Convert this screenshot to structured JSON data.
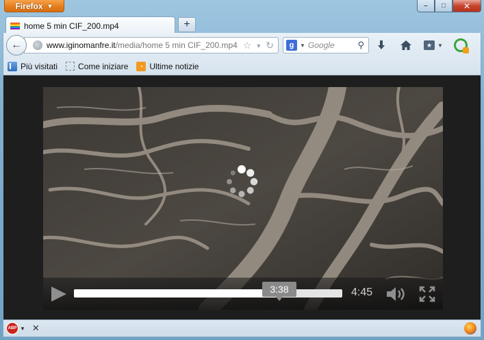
{
  "window": {
    "app_button_label": "Firefox",
    "controls": {
      "minimize": "–",
      "maximize": "□",
      "close": "✕"
    }
  },
  "tabs": [
    {
      "title": "home 5 min CIF_200.mp4",
      "favicon_colors": [
        "#e53935",
        "#fb8c00",
        "#fdd835",
        "#43a047",
        "#1e88e5",
        "#8e24aa"
      ]
    }
  ],
  "new_tab_label": "+",
  "navbar": {
    "url_domain": "www.iginomanfre.it",
    "url_path": "/media/home 5 min CIF_200.mp4",
    "search_engine_letter": "g",
    "search_placeholder": "Google"
  },
  "bookmarks": [
    {
      "label": "Più visitati",
      "icon": "bookmark-icon"
    },
    {
      "label": "Come iniziare",
      "icon": "dashed-page-icon"
    },
    {
      "label": "Ultime notizie",
      "icon": "rss-icon"
    }
  ],
  "player": {
    "hover_time": "3:38",
    "duration": "4:45",
    "progress_fraction": 0.765,
    "state": "buffering"
  },
  "statusbar": {
    "abp_label": "ABP",
    "close_label": "✕"
  },
  "colors": {
    "firefox_orange": "#e57f1e",
    "content_bg": "#1e1e1e",
    "progress": "#ffffff"
  }
}
